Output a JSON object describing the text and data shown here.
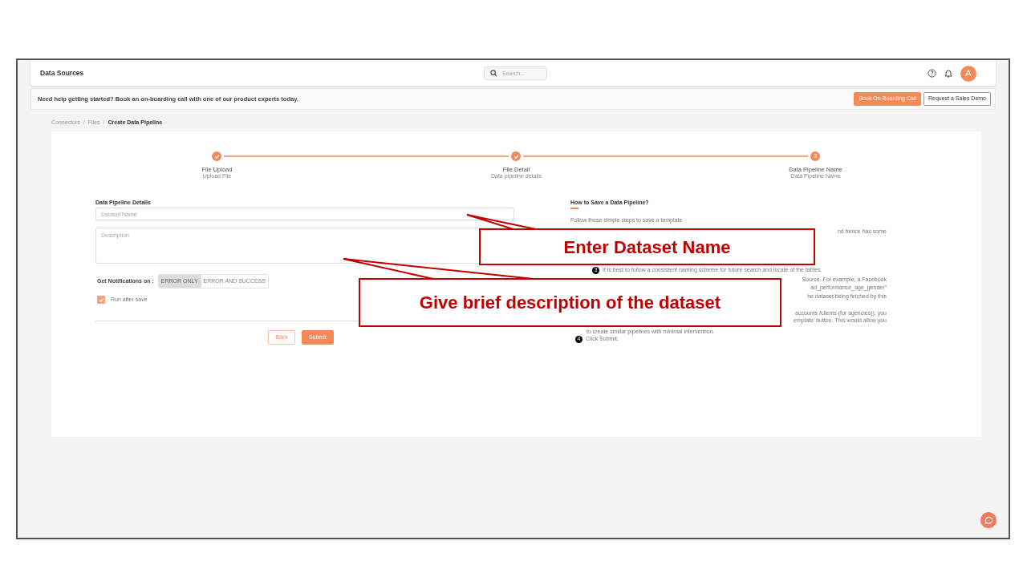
{
  "header": {
    "title": "Data Sources",
    "search": {
      "placeholder": "Search..."
    },
    "avatar": "A"
  },
  "banner": {
    "text": "Need help getting started? Book an on-boarding call with one of our product experts today.",
    "buttons": [
      {
        "label": "Book On-Boarding Call",
        "kind": "primary"
      },
      {
        "label": "Request a Sales Demo",
        "kind": "outline"
      }
    ]
  },
  "breadcrumb": {
    "separator": "/",
    "items": [
      {
        "label": "Connectors",
        "current": false
      },
      {
        "label": "Files",
        "current": false
      },
      {
        "label": "Create Data Pipeline",
        "current": true
      }
    ]
  },
  "steps": [
    {
      "label": "File Upload",
      "sublabel": "Upload File",
      "completed": true
    },
    {
      "label": "File Detail",
      "sublabel": "Data pipeline details",
      "completed": true
    },
    {
      "label": "Data Pipeline Name",
      "sublabel": "Data Pipeline Name",
      "completed": false,
      "number": "3"
    }
  ],
  "form": {
    "title": "Data Pipeline Details",
    "fields": [
      {
        "kind": "input",
        "placeholder": "Dataset Name"
      },
      {
        "kind": "textarea",
        "placeholder": "Description"
      }
    ],
    "notifications": {
      "label": "Get Notifications on :",
      "options": [
        {
          "label": "ERROR ONLY",
          "selected": true
        },
        {
          "label": "ERROR AND SUCCESS",
          "selected": false
        }
      ]
    },
    "run_after_save": {
      "label": "Run after save",
      "checked": true
    },
    "buttons": [
      {
        "label": "Back",
        "kind": "outline"
      },
      {
        "label": "Submit",
        "kind": "primary"
      }
    ]
  },
  "help": {
    "title": "How to Save a Data Pipeline?",
    "lines": [
      {
        "kind": "text",
        "text": "Follow these simple steps to save a template"
      },
      {
        "kind": "tail",
        "text": "nd hence has some"
      },
      {
        "kind": "step",
        "number": "3",
        "text": "It is best to follow a consistent naming scheme for future search and locate of the tables."
      },
      {
        "kind": "tail",
        "text": "Source. For example, a Facebook"
      },
      {
        "kind": "tail",
        "text": "ad_performance_age_gender\""
      },
      {
        "kind": "tail",
        "text": "he dataset being fetched by this"
      },
      {
        "kind": "tail",
        "text": "accounts /clients (for agencies)), you"
      },
      {
        "kind": "tail",
        "text": "emplate' button. This would allow you"
      },
      {
        "kind": "continuation",
        "text": "to create similar pipelines with minimal intervention."
      },
      {
        "kind": "step",
        "number": "4",
        "text": "Click Submit."
      }
    ]
  },
  "callouts": [
    {
      "text": "Enter Dataset Name"
    },
    {
      "text": "Give brief description of the dataset"
    }
  ]
}
